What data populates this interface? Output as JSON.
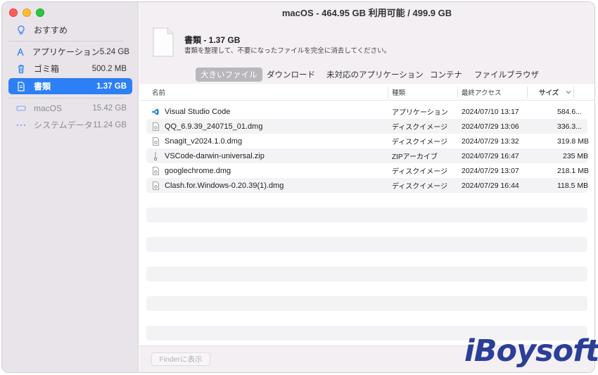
{
  "window": {
    "title": "macOS - 464.95 GB 利用可能 / 499.9 GB"
  },
  "sidebar": {
    "items": [
      {
        "label": "おすすめ",
        "value": "",
        "icon": "lightbulb-icon"
      },
      {
        "label": "アプリケーション",
        "value": "5.24 GB",
        "icon": "applications-icon"
      },
      {
        "label": "ゴミ箱",
        "value": "500.2 MB",
        "icon": "trash-icon"
      },
      {
        "label": "書類",
        "value": "1.37 GB",
        "icon": "document-icon",
        "active": true
      },
      {
        "label": "macOS",
        "value": "15.42 GB",
        "icon": "disk-icon"
      },
      {
        "label": "システムデータ",
        "value": "11.24 GB",
        "icon": "ellipsis-icon"
      }
    ]
  },
  "header": {
    "title": "書類 - 1.37 GB",
    "description": "書類を整理して、不要になったファイルを完全に消去してください。"
  },
  "tabs": [
    {
      "label": "大きいファイル",
      "active": true
    },
    {
      "label": "ダウンロード"
    },
    {
      "label": "未対応のアプリケーション"
    },
    {
      "label": "コンテナ"
    },
    {
      "label": "ファイルブラウザ"
    }
  ],
  "table": {
    "columns": {
      "name": "名前",
      "kind": "種類",
      "last_access": "最終アクセス",
      "size": "サイズ"
    },
    "rows": [
      {
        "name": "Visual Studio Code",
        "kind": "アプリケーション",
        "last_access": "2024/07/10 13:17",
        "size": "584.6...",
        "icon": "vscode-icon"
      },
      {
        "name": "QQ_6.9.39_240715_01.dmg",
        "kind": "ディスクイメージ",
        "last_access": "2024/07/29 13:06",
        "size": "336.3...",
        "icon": "disk-image-icon"
      },
      {
        "name": "Snagit_v2024.1.0.dmg",
        "kind": "ディスクイメージ",
        "last_access": "2024/07/29 13:32",
        "size": "319.8 MB",
        "icon": "disk-image-icon"
      },
      {
        "name": "VSCode-darwin-universal.zip",
        "kind": "ZIPアーカイブ",
        "last_access": "2024/07/29 16:47",
        "size": "235 MB",
        "icon": "zip-icon"
      },
      {
        "name": "googlechrome.dmg",
        "kind": "ディスクイメージ",
        "last_access": "2024/07/29 13:07",
        "size": "218.1 MB",
        "icon": "disk-image-icon"
      },
      {
        "name": "Clash.for.Windows-0.20.39(1).dmg",
        "kind": "ディスクイメージ",
        "last_access": "2024/07/29 16:44",
        "size": "118.5 MB",
        "icon": "disk-image-icon"
      }
    ]
  },
  "footer": {
    "finder_button": "Finderに表示"
  },
  "watermark": "iBoysoft",
  "colors": {
    "accent": "#2d7ff6",
    "sidebar_bg": "#e8e4ea",
    "brand": "#2a3f97"
  }
}
